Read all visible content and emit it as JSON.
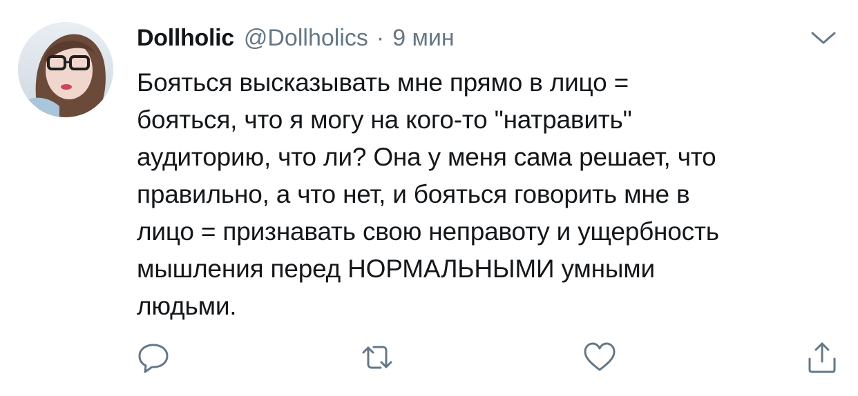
{
  "tweet": {
    "display_name": "Dollholic",
    "handle": "@Dollholics",
    "separator": "·",
    "time": "9 мин",
    "text_lines": [
      "Бояться высказывать мне прямо в лицо =",
      "бояться, что я могу на кого-то \"натравить\"",
      "аудиторию, что ли? Она у меня сама решает, что",
      "правильно, а что нет, и бояться говорить мне в",
      "лицо = признавать свою неправоту и ущербность",
      "мышления перед НОРМАЛЬНЫМИ умными",
      "людьми."
    ]
  },
  "icons": {
    "avatar": "avatar-photo",
    "menu": "chevron-down-icon",
    "reply": "reply-icon",
    "retweet": "retweet-icon",
    "like": "heart-icon",
    "share": "share-icon"
  },
  "colors": {
    "text": "#14171a",
    "secondary": "#657786",
    "icon": "#657786",
    "background": "#ffffff"
  }
}
